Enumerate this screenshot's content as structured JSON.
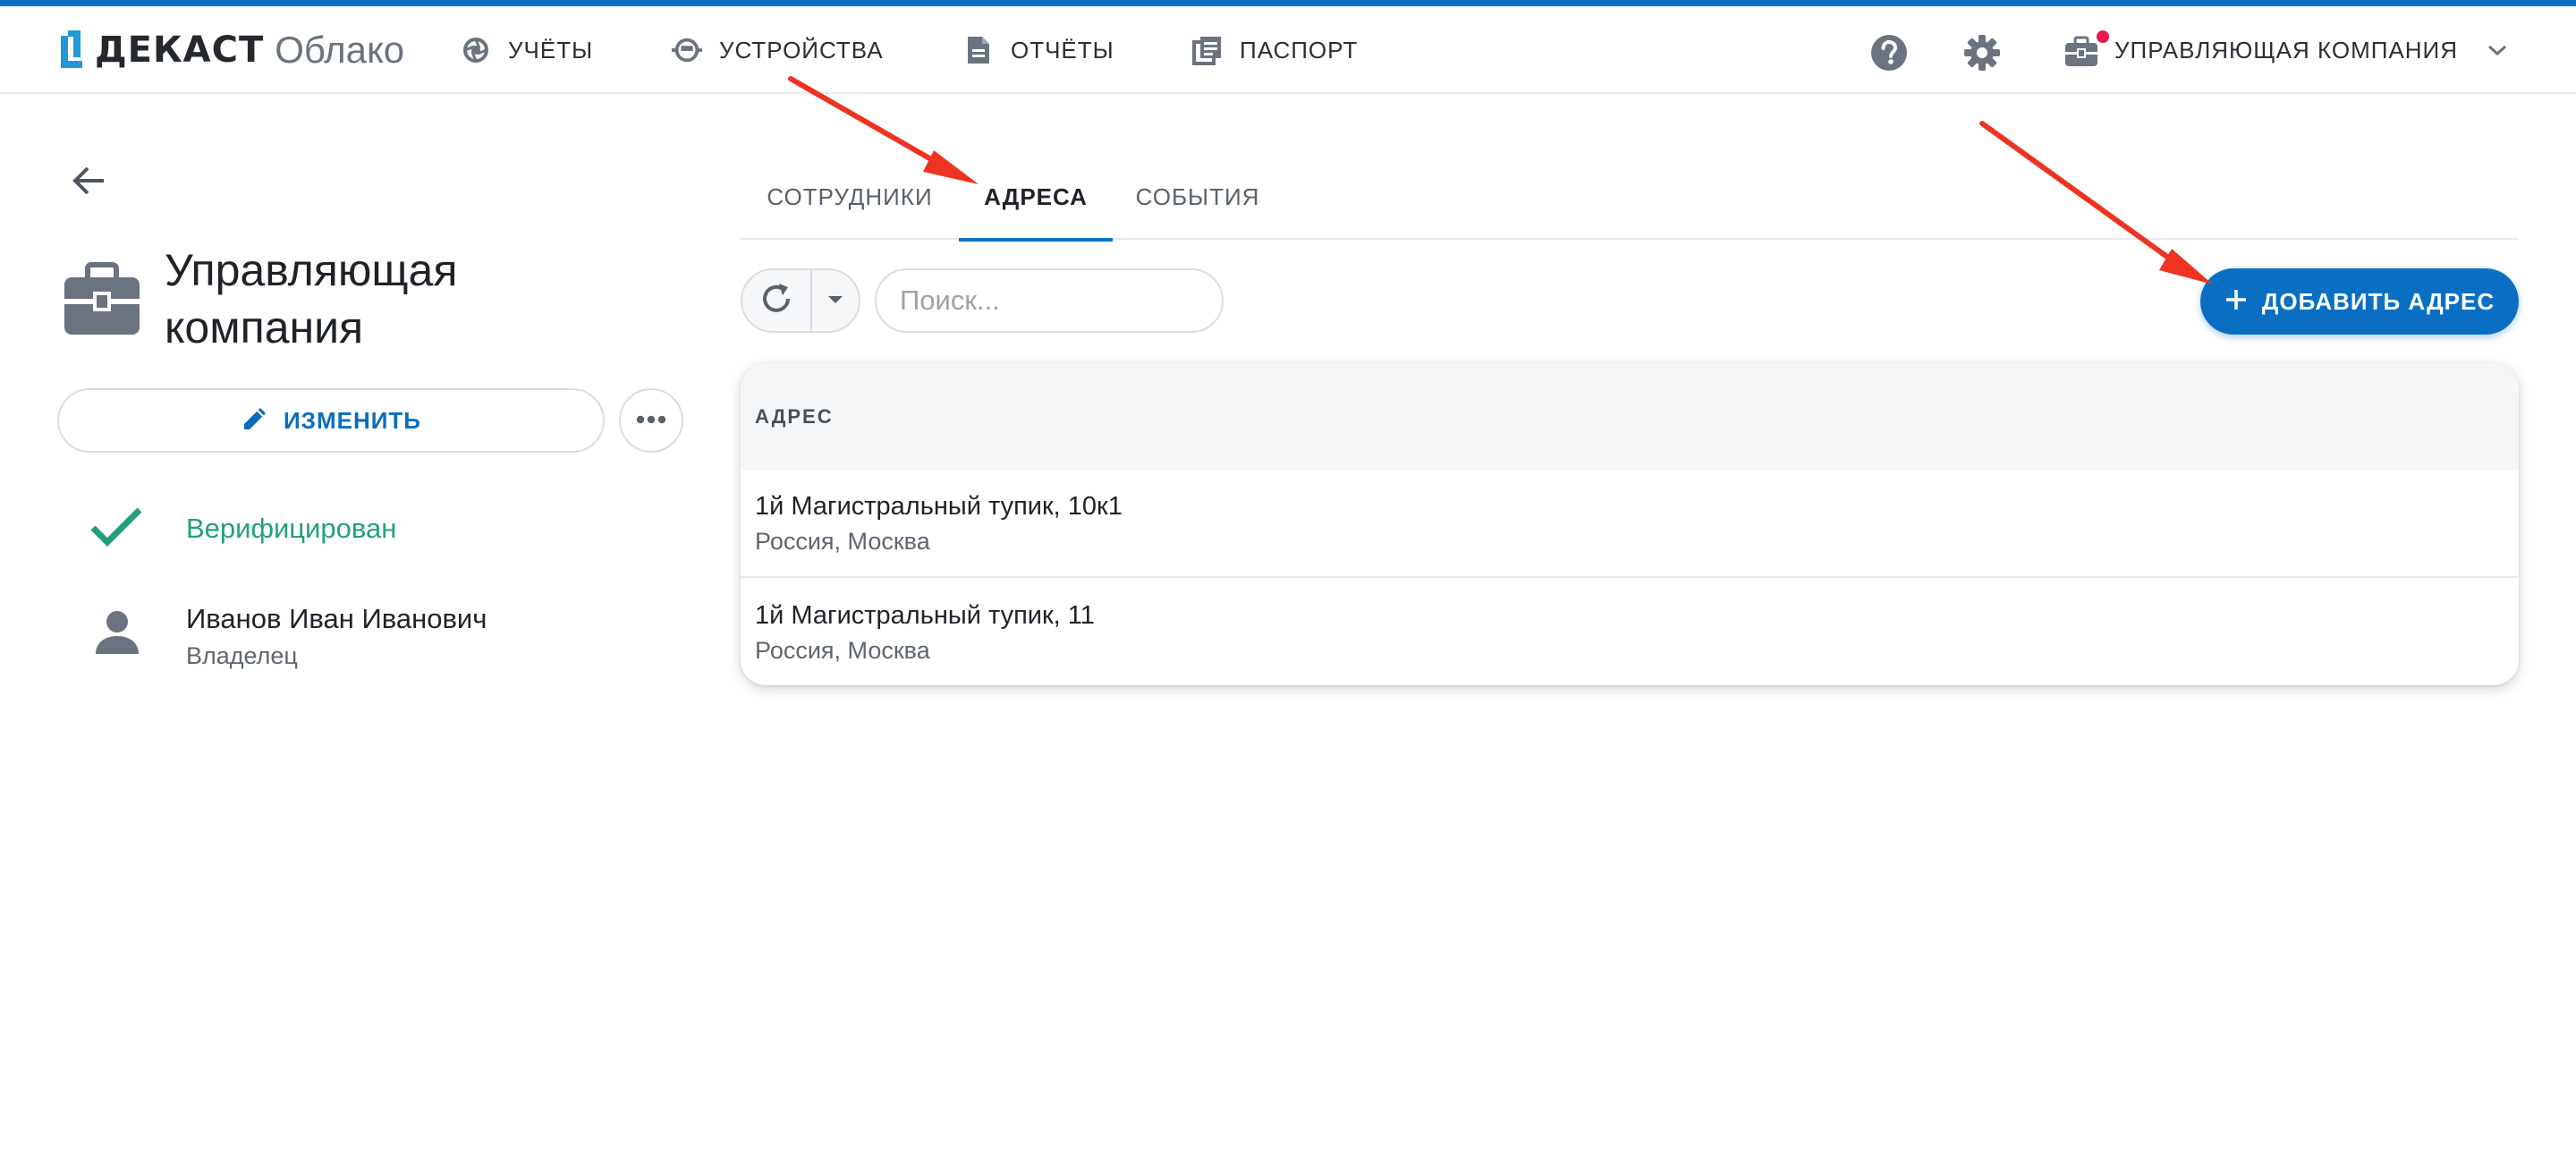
{
  "colors": {
    "accent": "#0a72c6",
    "primary_button": "#0a6fc3",
    "verified": "#22a07d",
    "notification": "#e8194e",
    "annotation_arrow": "#ee3322"
  },
  "header": {
    "logo": {
      "brand": "ДЕКАСТ",
      "product": "Облако"
    },
    "nav": [
      {
        "label": "УЧЁТЫ",
        "icon": "aperture-icon"
      },
      {
        "label": "УСТРОЙСТВА",
        "icon": "meter-device-icon"
      },
      {
        "label": "ОТЧЁТЫ",
        "icon": "document-icon"
      },
      {
        "label": "ПАСПОРТ",
        "icon": "passport-book-icon"
      }
    ],
    "help_icon": "help-icon",
    "settings_icon": "gear-icon",
    "company_menu": {
      "label": "УПРАВЛЯЮЩАЯ КОМПАНИЯ",
      "icon": "briefcase-icon",
      "has_notification": true
    }
  },
  "sidebar": {
    "title": "Управляющая компания",
    "edit_label": "ИЗМЕНИТЬ",
    "status": {
      "label": "Верифицирован",
      "icon": "check-icon"
    },
    "owner": {
      "name": "Иванов Иван Иванович",
      "role": "Владелец",
      "icon": "person-icon"
    }
  },
  "tabs": [
    {
      "label": "СОТРУДНИКИ",
      "active": false
    },
    {
      "label": "АДРЕСА",
      "active": true
    },
    {
      "label": "СОБЫТИЯ",
      "active": false
    }
  ],
  "toolbar": {
    "search_placeholder": "Поиск...",
    "search_value": "",
    "add_label": "ДОБАВИТЬ АДРЕС"
  },
  "table": {
    "column": "АДРЕС",
    "rows": [
      {
        "title": "1й Магистральный тупик, 10к1",
        "subtitle": "Россия, Москва"
      },
      {
        "title": "1й Магистральный тупик, 11",
        "subtitle": "Россия, Москва"
      }
    ]
  }
}
